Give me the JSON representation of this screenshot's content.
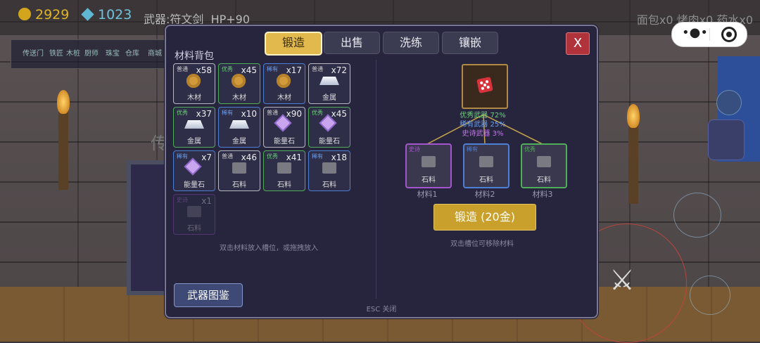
{
  "hud": {
    "gold": "2929",
    "gems": "1023",
    "weapon": "武器:符文剑",
    "hp": "HP+90",
    "food": "面包x0 烤肉x0 药水x0"
  },
  "nav_strip": [
    "传送门",
    "铁匠",
    "木桩",
    "厨师",
    "珠宝",
    "仓库",
    "商城"
  ],
  "background_sign": "传",
  "panel": {
    "tabs": [
      "锻造",
      "出售",
      "洗练",
      "镶嵌"
    ],
    "active_tab": "锻造",
    "close_label": "X",
    "inventory_title": "材料背包",
    "inventory": [
      {
        "quality": "普通",
        "count": "x58",
        "name": "木材",
        "icon": "wood-icon",
        "tier": "common"
      },
      {
        "quality": "优秀",
        "count": "x45",
        "name": "木材",
        "icon": "wood-icon",
        "tier": "good"
      },
      {
        "quality": "稀有",
        "count": "x17",
        "name": "木材",
        "icon": "wood-icon",
        "tier": "rare"
      },
      {
        "quality": "普通",
        "count": "x72",
        "name": "金属",
        "icon": "metal-icon",
        "tier": "common"
      },
      {
        "quality": "优秀",
        "count": "x37",
        "name": "金属",
        "icon": "metal-icon",
        "tier": "good"
      },
      {
        "quality": "稀有",
        "count": "x10",
        "name": "金属",
        "icon": "metal-icon",
        "tier": "rare"
      },
      {
        "quality": "普通",
        "count": "x90",
        "name": "能量石",
        "icon": "crystal-icon",
        "tier": "common"
      },
      {
        "quality": "优秀",
        "count": "x45",
        "name": "能量石",
        "icon": "crystal-icon",
        "tier": "good"
      },
      {
        "quality": "稀有",
        "count": "x7",
        "name": "能量石",
        "icon": "crystal-icon",
        "tier": "rare"
      },
      {
        "quality": "普通",
        "count": "x46",
        "name": "石料",
        "icon": "stone-icon",
        "tier": "common"
      },
      {
        "quality": "优秀",
        "count": "x41",
        "name": "石料",
        "icon": "stone-icon",
        "tier": "good"
      },
      {
        "quality": "稀有",
        "count": "x18",
        "name": "石料",
        "icon": "stone-icon",
        "tier": "rare"
      },
      {
        "quality": "史诗",
        "count": "x1",
        "name": "石料",
        "icon": "stone-icon",
        "tier": "epic"
      }
    ],
    "inventory_hint": "双击材料放入槽位，或拖拽放入",
    "odds": [
      "优秀武器 72%",
      "稀有武器 25%",
      "史诗武器 3%"
    ],
    "recipe": [
      {
        "quality": "史诗",
        "name": "石料",
        "label": "材料1",
        "tier": "epic"
      },
      {
        "quality": "稀有",
        "name": "石料",
        "label": "材料2",
        "tier": "rare"
      },
      {
        "quality": "优秀",
        "name": "石料",
        "label": "材料3",
        "tier": "good"
      }
    ],
    "forge_button": "锻造 (20金)",
    "forge_hint": "双击槽位可移除材料",
    "codex_button": "武器图鉴",
    "esc_hint": "ESC 关闭"
  },
  "colors": {
    "common": "#b7b7c2",
    "good": "#4fae58",
    "rare": "#4c7fd6",
    "epic": "#a554cf",
    "accent": "#e2b94c"
  }
}
